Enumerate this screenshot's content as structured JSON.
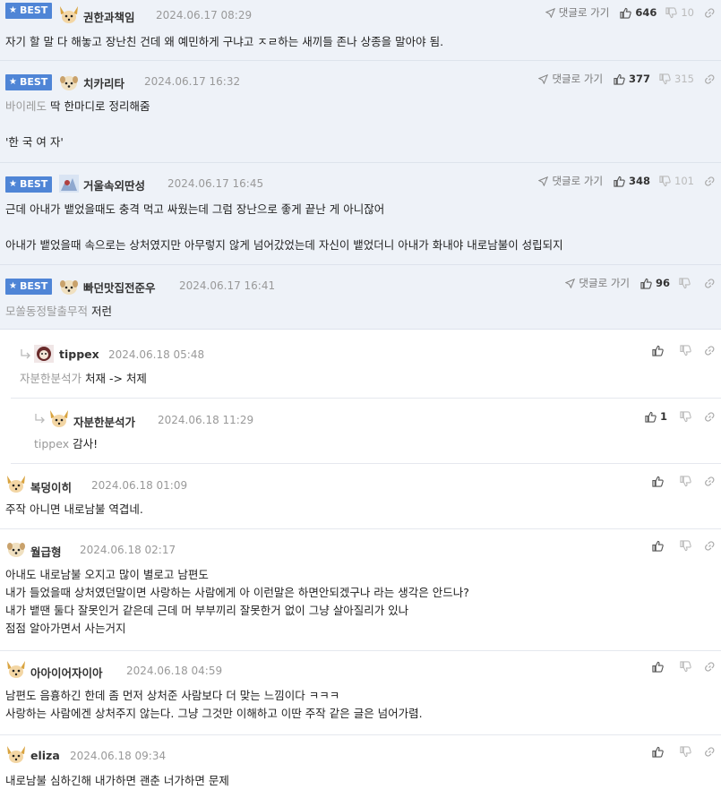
{
  "best_label": "BEST",
  "goto_label": "댓글로 가기",
  "comments": [
    {
      "nick": "권한과책임",
      "date": "2024.06.17 08:29",
      "up": "646",
      "down": "10",
      "body": "자기 할 말 다 해놓고 장난친 건데 왜 예민하게 구냐고 ㅈㄹ하는 새끼들 존나 상종을 말아야 됨."
    },
    {
      "nick": "치카리타",
      "date": "2024.06.17 16:32",
      "up": "377",
      "down": "315",
      "mention": "바이레도",
      "body": "딱 한마디로 정리해줌\n\n'한 국 여 자'"
    },
    {
      "nick": "거울속외딴성",
      "date": "2024.06.17 16:45",
      "up": "348",
      "down": "101",
      "body": "근데 아내가 뱉었을때도 충격 먹고 싸웠는데 그럼 장난으로 좋게 끝난 게 아니잖어\n\n아내가 뱉었을때 속으로는 상처였지만 아무렇지 않게 넘어갔었는데 자신이 뱉었더니 아내가 화내야 내로남불이 성립되지"
    },
    {
      "nick": "빠던맛집전준우",
      "date": "2024.06.17 16:41",
      "up": "96",
      "down": "",
      "mention": "모쏠동정탈출무적",
      "body": "저런"
    },
    {
      "nick": "tippex",
      "date": "2024.06.18 05:48",
      "up": "",
      "down": "",
      "mention": "자분한분석가",
      "body": "처재 -> 처제"
    },
    {
      "nick": "자분한분석가",
      "date": "2024.06.18 11:29",
      "up": "1",
      "down": "",
      "mention": "tippex",
      "body": "감사!"
    },
    {
      "nick": "복덩이히",
      "date": "2024.06.18 01:09",
      "up": "",
      "down": "",
      "body": "주작 아니면 내로남불 역겹네."
    },
    {
      "nick": "월급형",
      "date": "2024.06.18 02:17",
      "up": "",
      "down": "",
      "body": "아내도 내로남불 오지고 많이 별로고 남편도\n내가 들었을때 상처였던말이면 사랑하는 사람에게 아 이런말은 하면안되겠구나 라는 생각은 안드나?\n내가 뱉땐 둘다 잘못인거 같은데 근데 머 부부끼리 잘못한거 없이 그냥 살아질리가 있나\n점점 알아가면서 사는거지"
    },
    {
      "nick": "아아이어자이아",
      "date": "2024.06.18 04:59",
      "up": "",
      "down": "",
      "body": "남편도 음흉하긴 한데 좀 먼저 상처준 사람보다 더 맞는 느낌이다 ㅋㅋㅋ\n사랑하는 사람에겐 상처주지 않는다. 그냥 그것만 이해하고 이딴 주작 같은 글은 넘어가렴."
    },
    {
      "nick": "eliza",
      "date": "2024.06.18 09:34",
      "up": "",
      "down": "",
      "body": "내로남불 심하긴해 내가하면 괜춘 너가하면 문제"
    }
  ]
}
